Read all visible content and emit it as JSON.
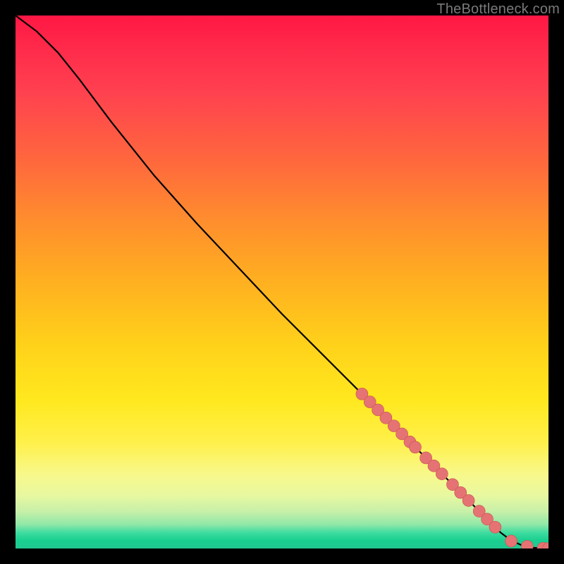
{
  "watermark": "TheBottleneck.com",
  "colors": {
    "marker_fill": "#e57373",
    "marker_stroke": "#c74f4f",
    "curve": "#000000"
  },
  "chart_data": {
    "type": "line",
    "title": "",
    "xlabel": "",
    "ylabel": "",
    "xlim": [
      0,
      100
    ],
    "ylim": [
      0,
      100
    ],
    "grid": false,
    "legend": false,
    "curve": {
      "x": [
        0,
        4,
        8,
        12,
        18,
        26,
        34,
        42,
        50,
        58,
        66,
        74,
        82,
        88,
        91,
        93,
        95,
        97,
        98.5,
        100
      ],
      "y": [
        100,
        97,
        93,
        88,
        80,
        70,
        61,
        52.5,
        44,
        36,
        28,
        20,
        12,
        6,
        3,
        1.5,
        0.6,
        0.15,
        0.05,
        0
      ]
    },
    "markers": {
      "x": [
        65,
        66.5,
        68,
        69.5,
        71,
        72.5,
        74,
        75,
        77,
        78.5,
        80,
        82,
        83.5,
        85,
        87,
        88.5,
        90,
        93,
        96,
        99,
        100
      ],
      "y": [
        29,
        27.5,
        26,
        24.5,
        23,
        21.5,
        20,
        19,
        17,
        15.5,
        14,
        12,
        10.5,
        9,
        7,
        5.5,
        4,
        1.4,
        0.4,
        0.05,
        0
      ]
    }
  }
}
